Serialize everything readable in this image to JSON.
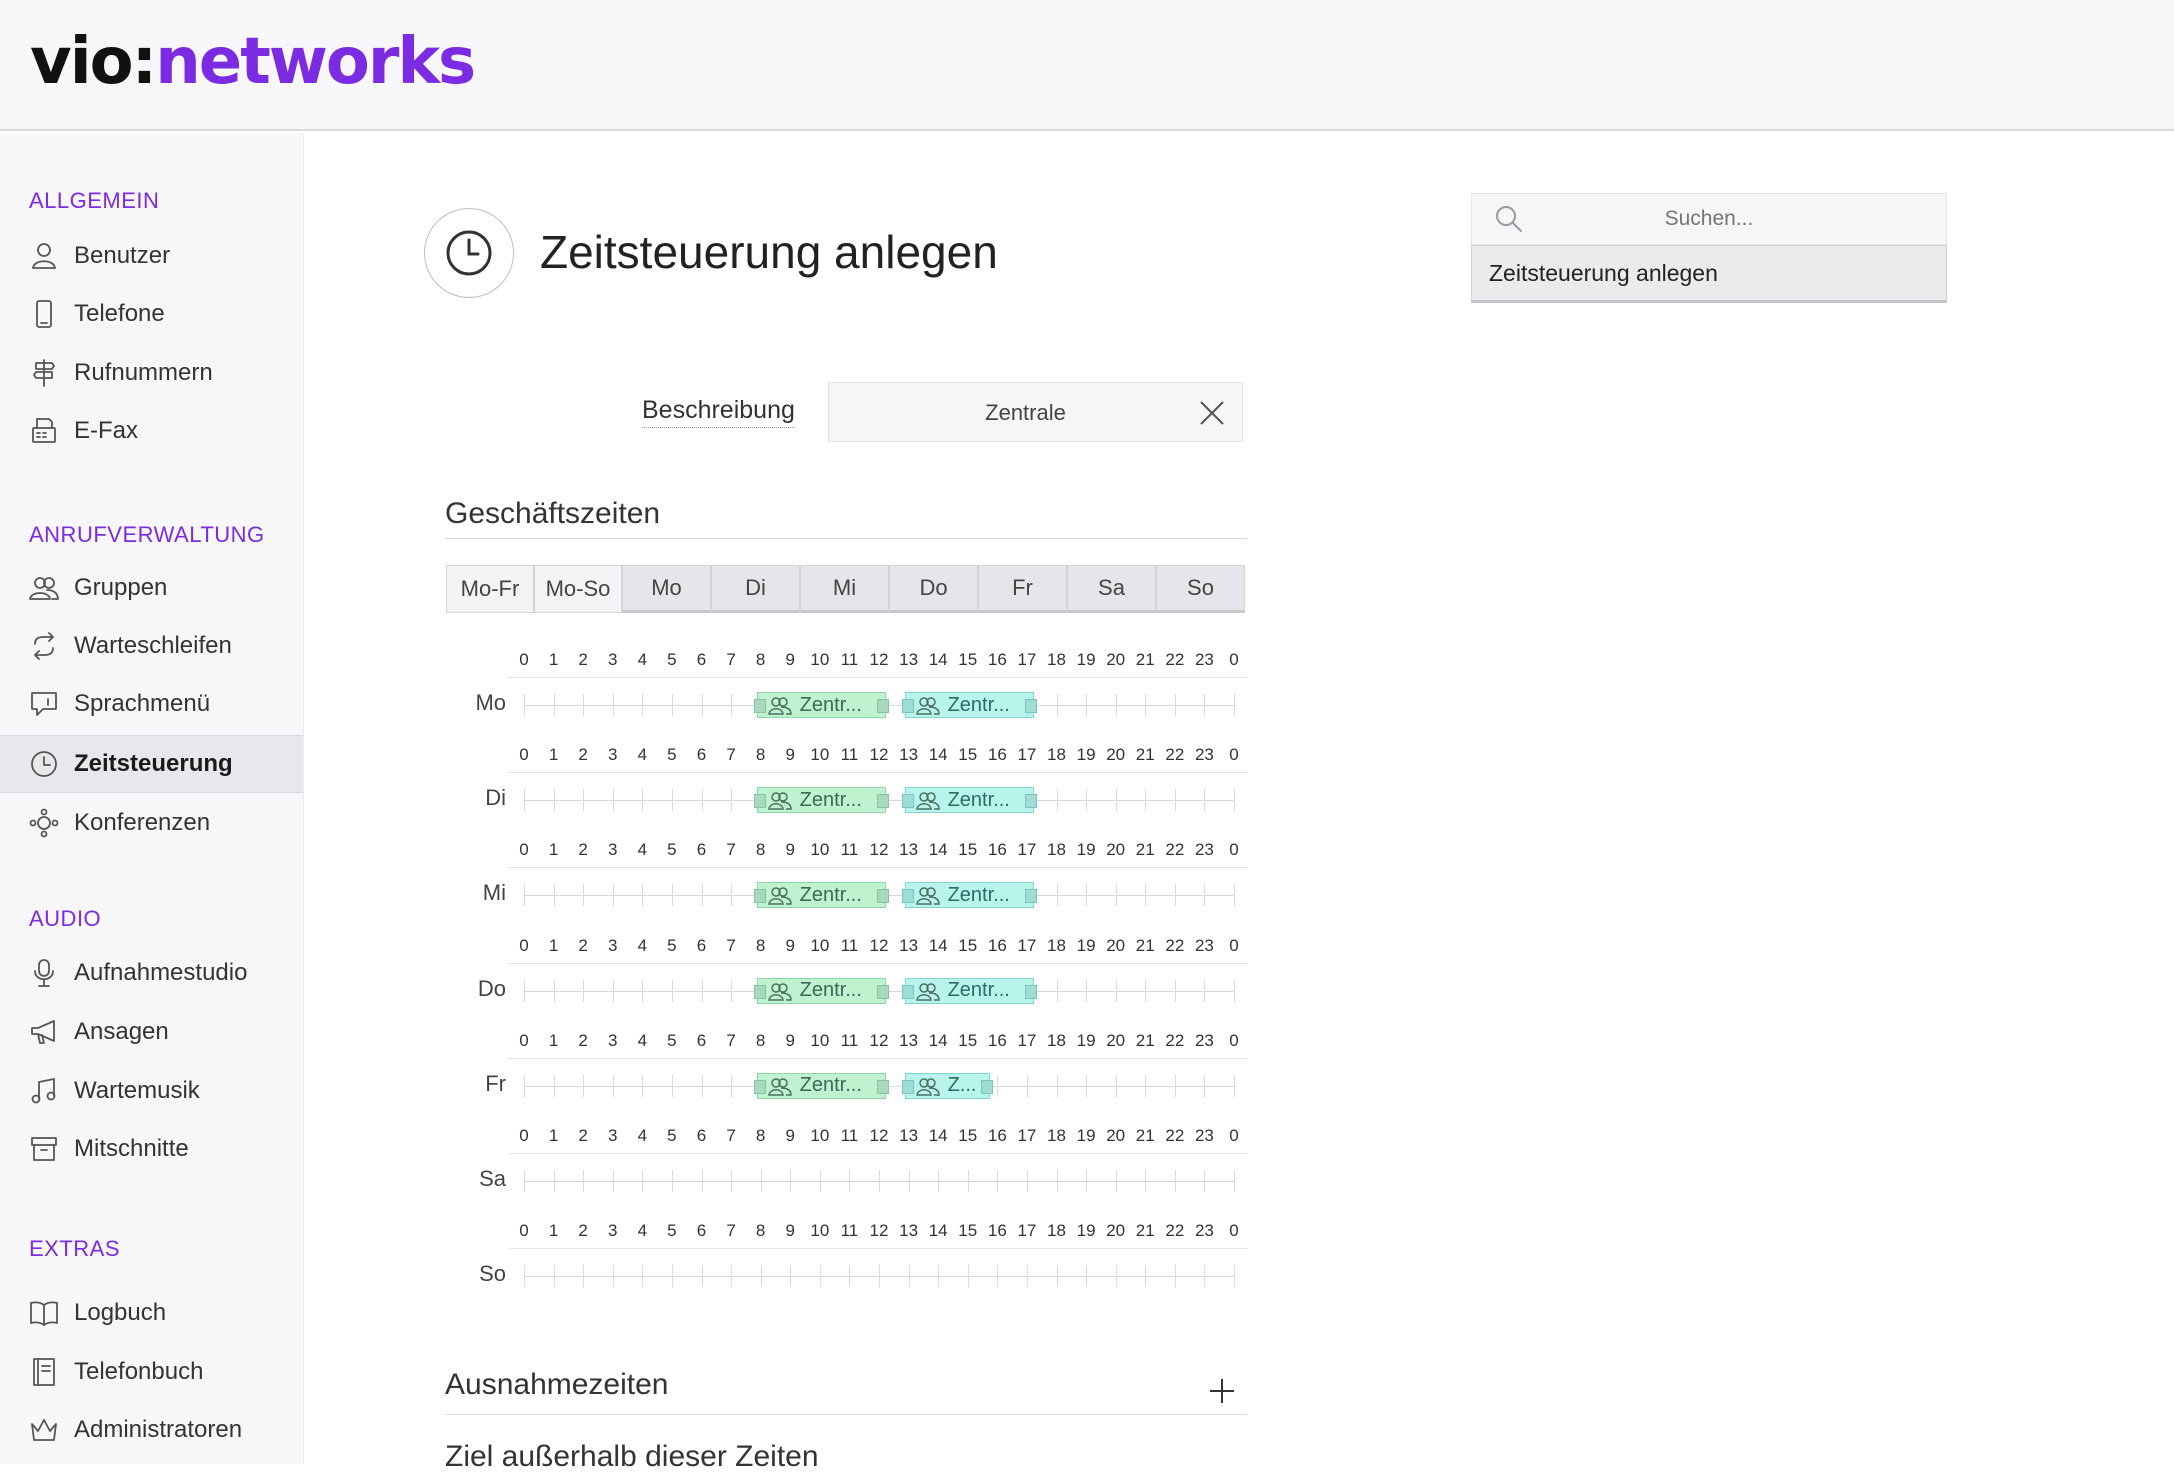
{
  "logo": {
    "part1": "vio:",
    "part2": "networks"
  },
  "sidebar": {
    "sections": [
      {
        "title": "ALLGEMEIN",
        "items": [
          {
            "label": "Benutzer",
            "icon": "user-icon"
          },
          {
            "label": "Telefone",
            "icon": "phone-icon"
          },
          {
            "label": "Rufnummern",
            "icon": "signpost-icon"
          },
          {
            "label": "E-Fax",
            "icon": "fax-icon"
          }
        ]
      },
      {
        "title": "ANRUFVERWALTUNG",
        "items": [
          {
            "label": "Gruppen",
            "icon": "group-icon"
          },
          {
            "label": "Warteschleifen",
            "icon": "loop-icon"
          },
          {
            "label": "Sprachmenü",
            "icon": "speech-menu-icon"
          },
          {
            "label": "Zeitsteuerung",
            "icon": "clock-icon",
            "active": true
          },
          {
            "label": "Konferenzen",
            "icon": "conference-icon"
          }
        ]
      },
      {
        "title": "AUDIO",
        "items": [
          {
            "label": "Aufnahmestudio",
            "icon": "microphone-icon"
          },
          {
            "label": "Ansagen",
            "icon": "megaphone-icon"
          },
          {
            "label": "Wartemusik",
            "icon": "music-icon"
          },
          {
            "label": "Mitschnitte",
            "icon": "archive-icon"
          }
        ]
      },
      {
        "title": "EXTRAS",
        "items": [
          {
            "label": "Logbuch",
            "icon": "book-icon"
          },
          {
            "label": "Telefonbuch",
            "icon": "phonebook-icon"
          },
          {
            "label": "Administratoren",
            "icon": "crown-icon"
          }
        ]
      }
    ]
  },
  "page": {
    "title": "Zeitsteuerung anlegen",
    "icon": "clock-icon"
  },
  "search": {
    "placeholder": "Suchen...",
    "result": "Zeitsteuerung anlegen"
  },
  "form": {
    "description_label": "Beschreibung",
    "description_value": "Zentrale"
  },
  "business_hours": {
    "title": "Geschäftszeiten",
    "group_tabs": [
      "Mo-Fr",
      "Mo-So"
    ],
    "day_tabs": [
      "Mo",
      "Di",
      "Mi",
      "Do",
      "Fr",
      "Sa",
      "So"
    ],
    "hour_labels": [
      "0",
      "1",
      "2",
      "3",
      "4",
      "5",
      "6",
      "7",
      "8",
      "9",
      "10",
      "11",
      "12",
      "13",
      "14",
      "15",
      "16",
      "17",
      "18",
      "19",
      "20",
      "21",
      "22",
      "23",
      "0"
    ],
    "days": [
      {
        "label": "Mo",
        "blocks": [
          {
            "text": "Zentr...",
            "start": 8,
            "end": 12.25,
            "color": "green"
          },
          {
            "text": "Zentr...",
            "start": 13,
            "end": 17.25,
            "color": "teal"
          }
        ]
      },
      {
        "label": "Di",
        "blocks": [
          {
            "text": "Zentr...",
            "start": 8,
            "end": 12.25,
            "color": "green"
          },
          {
            "text": "Zentr...",
            "start": 13,
            "end": 17.25,
            "color": "teal"
          }
        ]
      },
      {
        "label": "Mi",
        "blocks": [
          {
            "text": "Zentr...",
            "start": 8,
            "end": 12.25,
            "color": "green"
          },
          {
            "text": "Zentr...",
            "start": 13,
            "end": 17.25,
            "color": "teal"
          }
        ]
      },
      {
        "label": "Do",
        "blocks": [
          {
            "text": "Zentr...",
            "start": 8,
            "end": 12.25,
            "color": "green"
          },
          {
            "text": "Zentr...",
            "start": 13,
            "end": 17.25,
            "color": "teal"
          }
        ]
      },
      {
        "label": "Fr",
        "blocks": [
          {
            "text": "Zentr...",
            "start": 8,
            "end": 12.25,
            "color": "green"
          },
          {
            "text": "Z...",
            "start": 13,
            "end": 15.75,
            "color": "teal"
          }
        ]
      },
      {
        "label": "Sa",
        "blocks": []
      },
      {
        "label": "So",
        "blocks": []
      }
    ]
  },
  "exceptions": {
    "title": "Ausnahmezeiten",
    "add_icon": "plus-icon"
  },
  "fallback": {
    "title": "Ziel außerhalb dieser Zeiten"
  },
  "colors": {
    "brand": "#7b2be2",
    "block_green": "#bff2cf",
    "block_teal": "#b8f4ec"
  }
}
